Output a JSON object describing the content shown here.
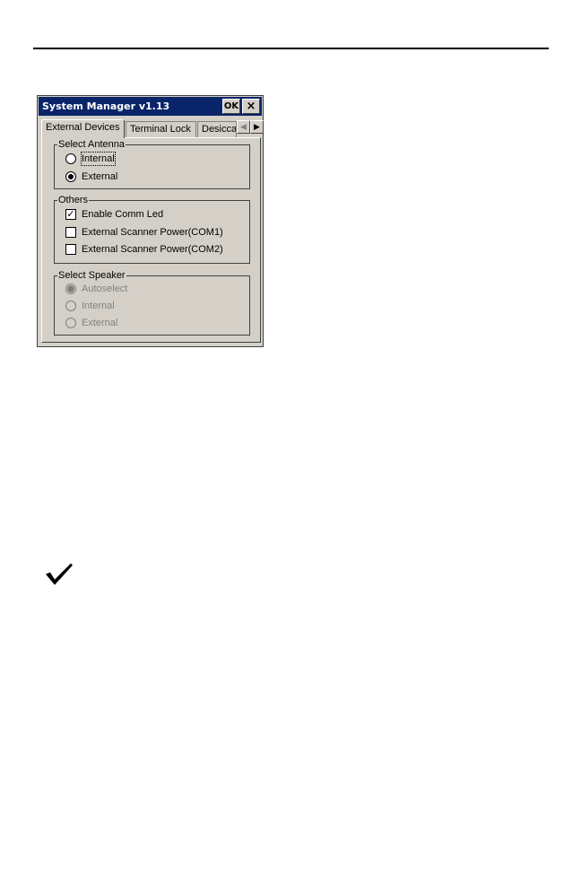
{
  "window": {
    "title": "System Manager v1.13",
    "ok_label": "OK",
    "close_label": "×"
  },
  "tabs": [
    {
      "label": "External Devices",
      "active": true
    },
    {
      "label": "Terminal Lock",
      "active": false
    },
    {
      "label": "Desiccant",
      "active": false
    }
  ],
  "tab_scroll": {
    "left_label": "◀",
    "right_label": "▶"
  },
  "groups": {
    "antenna": {
      "title": "Select Antenna",
      "options": [
        {
          "label": "Internal",
          "checked": false
        },
        {
          "label": "External",
          "checked": true
        }
      ]
    },
    "others": {
      "title": "Others",
      "options": [
        {
          "label": "Enable Comm Led",
          "checked": true
        },
        {
          "label": "External Scanner Power(COM1)",
          "checked": false
        },
        {
          "label": "External Scanner Power(COM2)",
          "checked": false
        }
      ]
    },
    "speaker": {
      "title": "Select Speaker",
      "options": [
        {
          "label": "Autoselect",
          "checked": true
        },
        {
          "label": "Internal",
          "checked": false
        },
        {
          "label": "External",
          "checked": false
        }
      ]
    }
  },
  "colors": {
    "titlebar": "#0a246a",
    "window_bg": "#d4d0c8",
    "disabled_text": "#808080"
  },
  "icons": {
    "note": "checkmark-icon"
  }
}
